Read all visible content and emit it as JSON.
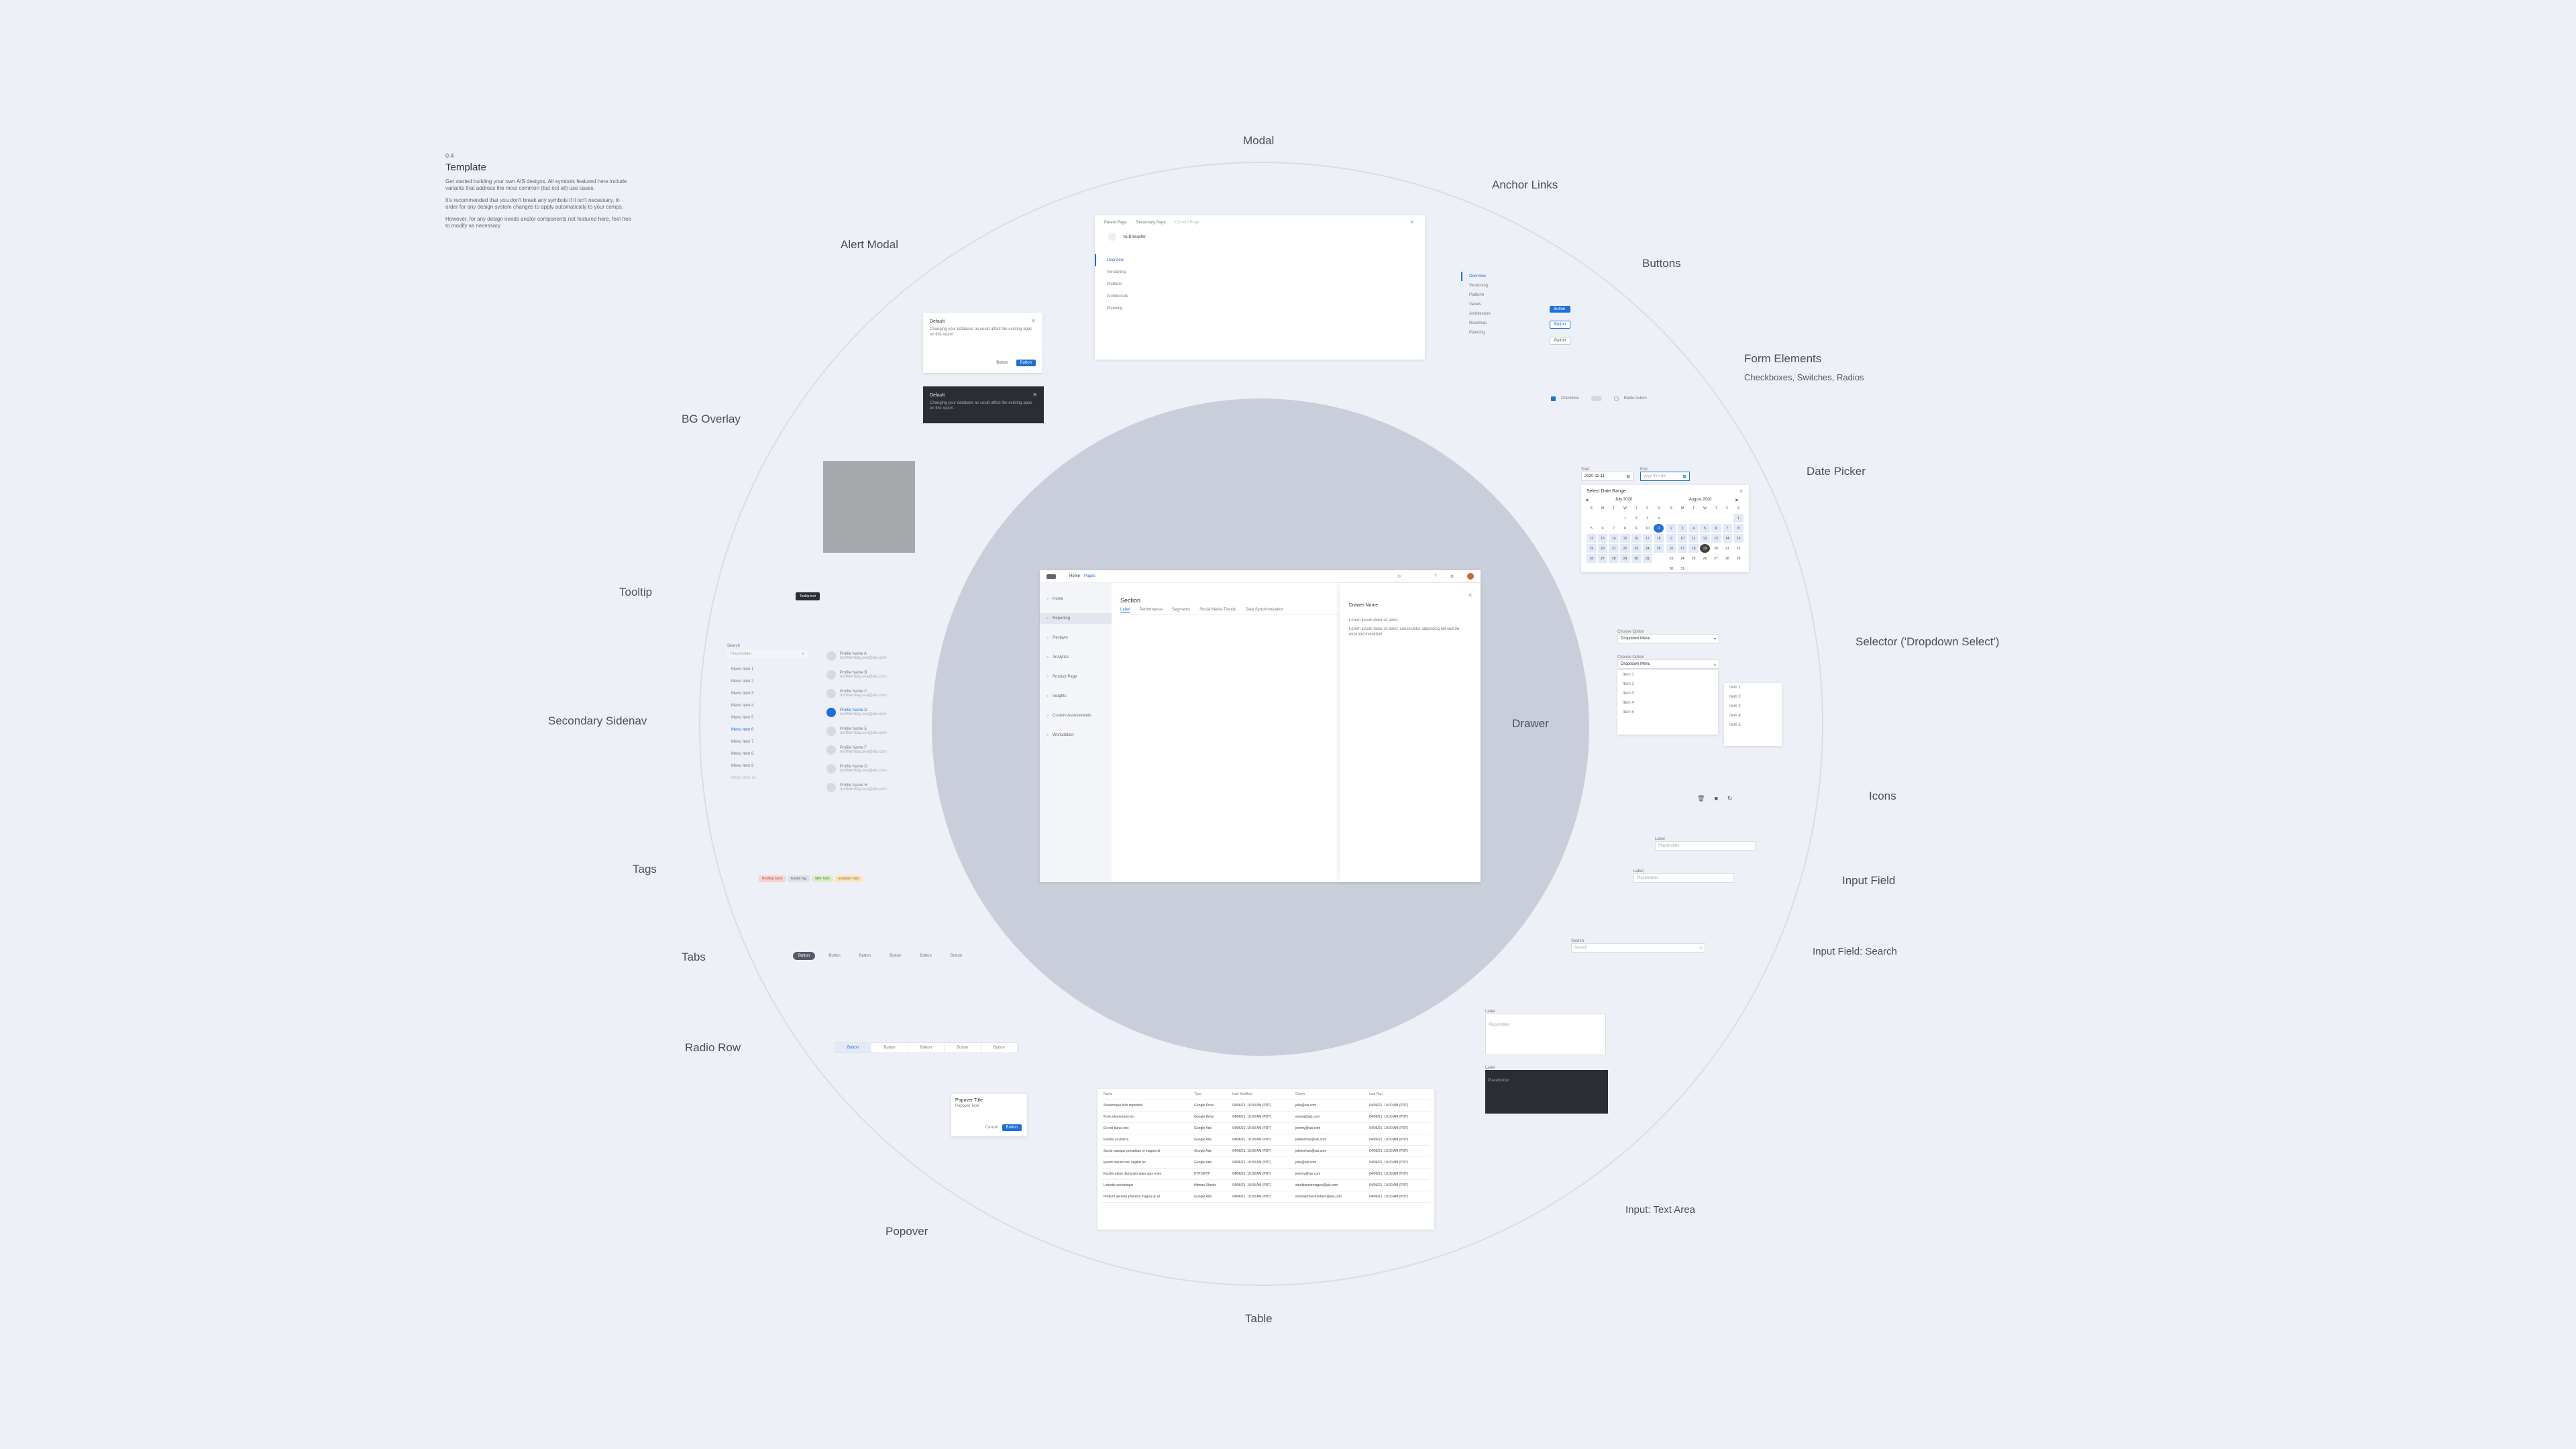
{
  "template": {
    "version": "0.4",
    "title": "Template",
    "paragraphs": [
      "Get started building your own AIS designs. All symbols featured here include variants that address the most common (but not all) use cases.",
      "It's recommended that you don't break any symbols if it isn't necessary, in order for any design system changes to apply automatically to your comps.",
      "However, for any design needs and/or components not featured here, feel free to modify as necessary."
    ]
  },
  "categories": {
    "modal": "Modal",
    "anchor_links": "Anchor Links",
    "buttons": "Buttons",
    "form_elements": "Form Elements",
    "form_elements_sub": "Checkboxes, Switches, Radios",
    "date_picker": "Date Picker",
    "selector": "Selector ('Dropdown Select')",
    "icons": "Icons",
    "input_field": "Input Field",
    "input_search": "Input Field: Search",
    "text_area": "Input: Text Area",
    "table": "Table",
    "popover": "Popover",
    "radio_row": "Radio Row",
    "tabs": "Tabs",
    "tags": "Tags",
    "secondary_sidenav": "Secondary Sidenav",
    "tooltip": "Tooltip",
    "bg_overlay": "BG Overlay",
    "alert_modal": "Alert Modal",
    "drawer": "Drawer"
  },
  "modal": {
    "breadcrumbs": [
      "Parent Page",
      "Secondary Page",
      "Current Page"
    ],
    "subheader": "Subheader",
    "nav": [
      "Overview",
      "Versioning",
      "Platform",
      "Architecture",
      "Planning"
    ]
  },
  "anchor_links": {
    "items": [
      "Overview",
      "Versioning",
      "Platform",
      "Values",
      "Architecture",
      "Roadmap",
      "Planning"
    ]
  },
  "buttons": {
    "labels": [
      "Button",
      "Button",
      "Button"
    ]
  },
  "form_elements": {
    "checkbox": "Checkbox",
    "radio": "Radio button"
  },
  "alert_modal": {
    "title": "Default",
    "body": "Changing your database as could affect the existing apps on this report.",
    "cancel": "Button",
    "confirm": "Button",
    "dark_title": "Default",
    "dark_body": "Changing your database as could affect the existing apps on this report."
  },
  "tooltip": {
    "text": "Tooltip text"
  },
  "app": {
    "nav_links": [
      "Home",
      "Pages"
    ],
    "sidebar": [
      "Home",
      "Reporting",
      "Reviews",
      "Analytics",
      "Product Page",
      "Insights",
      "Custom Assessments",
      "Workstation"
    ],
    "section_title": "Section",
    "tabs": [
      "Label",
      "Performance",
      "Segments",
      "Social Media Trends",
      "Data Synchronization"
    ],
    "drawer_title": "Drawer Name",
    "drawer_text1": "Lorem ipsum dolor sit amet.",
    "drawer_text2": "Lorem ipsum dolor sit amet, consectetur adipiscing elit sed do eiusmod incididunt."
  },
  "date_picker": {
    "start_label": "Start",
    "start_value": "2020-11-11",
    "end_label": "End",
    "end_placeholder": "yyyy-mm-dd",
    "panel_title": "Select Date Range",
    "month1": "July 2020",
    "month2": "August 2020",
    "weekdays": [
      "S",
      "M",
      "T",
      "W",
      "T",
      "F",
      "S"
    ]
  },
  "selector": {
    "label1": "Choose Option",
    "value1": "Dropdown Menu",
    "label2": "Choose Option",
    "value2": "Dropdown Menu",
    "items": [
      "Item 1",
      "Item 2",
      "Item 3",
      "Item 4",
      "Item 5"
    ],
    "items2": [
      "Item 1",
      "Item 2",
      "Item 3",
      "Item 4",
      "Item 5"
    ]
  },
  "inputs": {
    "label1": "Label",
    "placeholder1": "Placeholder",
    "label2": "Label",
    "placeholder2": "Placeholder",
    "search_label": "Search",
    "search_placeholder": "Search"
  },
  "text_area": {
    "label1": "Label",
    "placeholder1": "Placeholder",
    "label2": "Label",
    "placeholder2": "Placeholder"
  },
  "secondary_sidenav": {
    "search_label": "Search",
    "search_placeholder": "Placeholder",
    "menu": [
      "Menu Item 1",
      "Menu Item 2",
      "Menu Item 3",
      "Menu Item 4",
      "Menu Item 5",
      "Menu Item 6",
      "Menu Item 7",
      "Menu Item 8",
      "Menu Item 9",
      "Menu Item 10"
    ],
    "profiles": [
      {
        "name": "Profile Name A",
        "sub": "northernbay.sea@ais.com"
      },
      {
        "name": "Profile Name B",
        "sub": "northernbay.sea@ais.com"
      },
      {
        "name": "Profile Name C",
        "sub": "northernbay.sea@ais.com"
      },
      {
        "name": "Profile Name D",
        "sub": "northernbay.sea@ais.com"
      },
      {
        "name": "Profile Name E",
        "sub": "northernbay.sea@ais.com"
      },
      {
        "name": "Profile Name F",
        "sub": "northernbay.sea@ais.com"
      },
      {
        "name": "Profile Name G",
        "sub": "northernbay.sea@ais.com"
      },
      {
        "name": "Profile Name H",
        "sub": "northernbay.sea@ais.com"
      }
    ]
  },
  "tags": [
    {
      "label": "Rooftop Tarot",
      "bg": "#f7d2cf",
      "fg": "#b34a40"
    },
    {
      "label": "Koolbi Tag",
      "bg": "#dfe2e8",
      "fg": "#555"
    },
    {
      "label": "Mini Tabo",
      "bg": "#d9f0c7",
      "fg": "#4a7a2a"
    },
    {
      "label": "Example Tabo",
      "bg": "#fbe4bf",
      "fg": "#9a6a18"
    }
  ],
  "tabs": [
    "Button",
    "Button",
    "Button",
    "Button",
    "Button",
    "Button"
  ],
  "radio_row": [
    "Button",
    "Button",
    "Button",
    "Button",
    "Button"
  ],
  "popover": {
    "title": "Popover Title",
    "body": "Popover Text",
    "cancel": "Cancel",
    "confirm": "Button"
  },
  "table": {
    "headers": [
      "Name",
      "Type",
      "Last Modified",
      "Owner",
      "Last Run"
    ],
    "rows": [
      [
        "Scelerisque felis imperdiet",
        "Google Drive",
        "04/06/21, 10:00 AM (PDT)",
        "julie@ais.com",
        "04/06/21, 10:00 AM (PDT)"
      ],
      [
        "Proin elementum leo",
        "Google Drive",
        "04/06/21, 10:00 AM (PDT)",
        "emma@ais.com",
        "04/06/21, 10:00 AM (PDT)"
      ],
      [
        "Et orci purus orci",
        "Google Ads",
        "04/06/21, 10:00 AM (PDT)",
        "jeremy@ais.com",
        "04/06/21, 10:00 AM (PDT)"
      ],
      [
        "Facilisi ut viverra",
        "Google Ads",
        "04/06/21, 10:00 AM (PDT)",
        "julieterhuis@ais.com",
        "04/06/21, 10:00 AM (PDT)"
      ],
      [
        "Sociis natoque penatibus et magnis di",
        "Google Ads",
        "04/06/21, 10:00 AM (PDT)",
        "julieterhuis@ais.com",
        "04/06/21, 10:00 AM (PDT)"
      ],
      [
        "Ipsum mauris nec sagittis ac",
        "Google Ads",
        "04/06/21, 10:00 AM (PDT)",
        "julie@ais.com",
        "04/06/21, 10:00 AM (PDT)"
      ],
      [
        "Facilisi etiam dignissim diam quis enim",
        "FTP/SFTP",
        "04/06/21, 10:00 AM (PDT)",
        "jeremy@ais.com",
        "04/06/21, 10:00 AM (PDT)"
      ],
      [
        "Lobortis scelerisque",
        "Hitman Sheets",
        "04/06/21, 10:00 AM (PDT)",
        "steelbunniemagee@ais.com",
        "04/06/21, 10:00 AM (PDT)"
      ],
      [
        "Pretium aenean pharetra magna ac et",
        "Google Ads",
        "04/06/21, 10:00 AM (PDT)",
        "emmaterhuislumbers@ais.com",
        "04/06/21, 10:00 AM (PDT)"
      ]
    ]
  },
  "colors": {
    "background": "#edf0f7",
    "accent": "#1f6fd6",
    "inner_circle": "#c9cfda",
    "dark_surface": "#2b2d33"
  }
}
